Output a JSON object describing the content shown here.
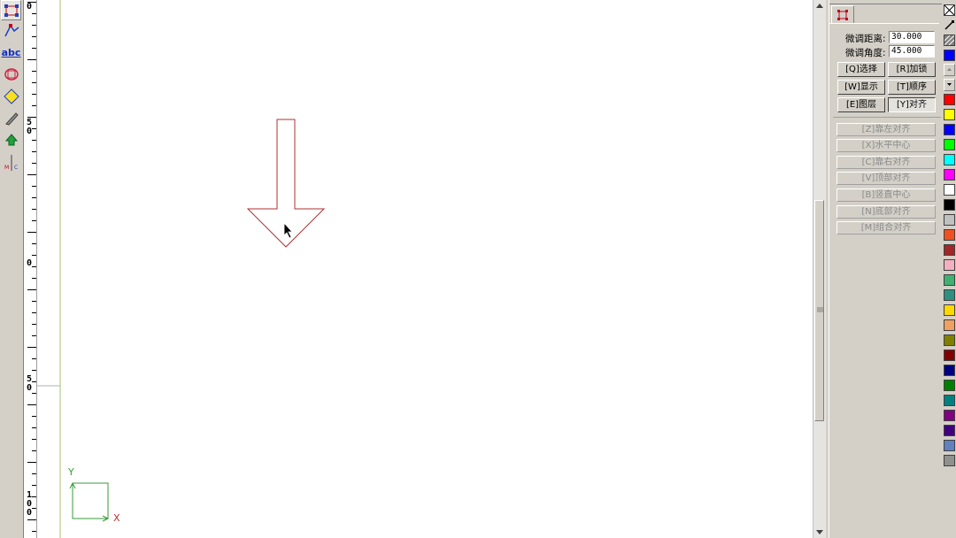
{
  "ruler": {
    "marks": [
      {
        "d1": "0",
        "d2": ""
      },
      {
        "d1": "5",
        "d2": "0"
      },
      {
        "d1": "0",
        "d2": ""
      },
      {
        "d1": "5",
        "d2": "0"
      },
      {
        "d1": "1",
        "d2": "0",
        "d3": "0"
      }
    ]
  },
  "left_toolbar": {
    "tools": [
      {
        "name": "select-tool-icon"
      },
      {
        "name": "node-edit-tool-icon"
      },
      {
        "name": "text-tool-icon",
        "text": "abc"
      },
      {
        "name": "shape-tool-icon"
      },
      {
        "name": "fill-tool-icon"
      },
      {
        "name": "knife-tool-icon"
      },
      {
        "name": "laser-tool-icon"
      },
      {
        "name": "measure-tool-icon"
      }
    ]
  },
  "canvas": {
    "axis_y_label": "Y",
    "axis_x_label": "X",
    "shape_color": "#b03030",
    "axis_color": "#3a9a3a"
  },
  "panel": {
    "tab_icon": "select-icon",
    "fine_distance_label": "微调距离:",
    "fine_distance_value": "30.000",
    "fine_angle_label": "微调角度:",
    "fine_angle_value": "45.000",
    "buttons": [
      {
        "id": "select",
        "label": "[Q]选择"
      },
      {
        "id": "lock",
        "label": "[R]加锁"
      },
      {
        "id": "display",
        "label": "[W]显示"
      },
      {
        "id": "order",
        "label": "[T]顺序"
      },
      {
        "id": "layer",
        "label": "[E]图层"
      },
      {
        "id": "align",
        "label": "[Y]对齐"
      }
    ],
    "align_options": [
      "[Z]靠左对齐",
      "[X]水平中心",
      "[C]靠右对齐",
      "[V]顶部对齐",
      "[B]竖直中心",
      "[N]底部对齐",
      "[M]组合对齐"
    ]
  },
  "palette": {
    "colors": [
      "#ff0000",
      "#ffff00",
      "#0000ff",
      "#00ff00",
      "#00ffff",
      "#ff00ff",
      "#ffffff",
      "#000000",
      "#c0c0c0",
      "#f05020",
      "#a02828",
      "#f4b0c0",
      "#40b070",
      "#309080",
      "#ffd800",
      "#f0a060",
      "#808000",
      "#800000",
      "#000080",
      "#008000",
      "#008080",
      "#800080",
      "#400080",
      "#6080c0",
      "#909090"
    ]
  }
}
